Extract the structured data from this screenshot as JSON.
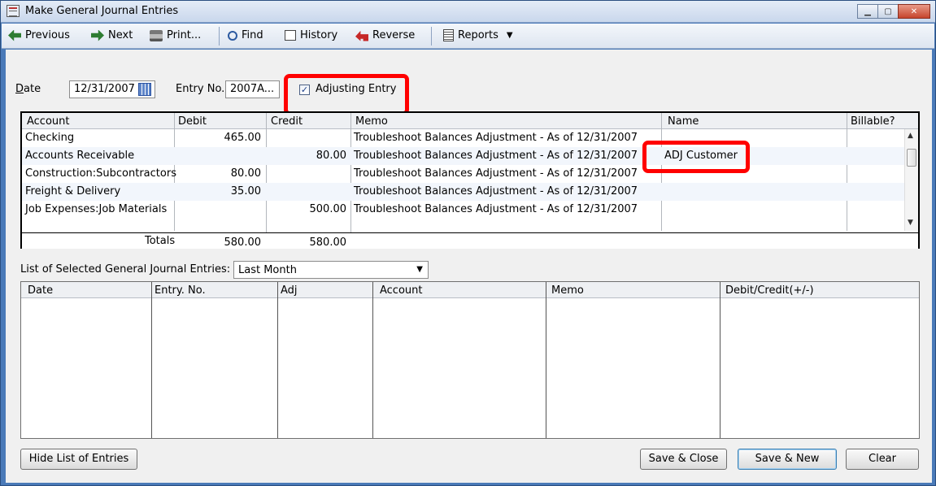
{
  "window": {
    "title": "Make General Journal Entries",
    "min_icon": "minimize-icon",
    "max_icon": "maximize-icon",
    "close_icon": "close-icon"
  },
  "toolbar": {
    "previous": "Previous",
    "next": "Next",
    "print": "Print...",
    "find": "Find",
    "history": "History",
    "reverse": "Reverse",
    "reports": "Reports"
  },
  "header": {
    "date_label": "Date",
    "date_value": "12/31/2007",
    "entry_label": "Entry No.",
    "entry_value": "2007A...",
    "adjusting_label": "Adjusting Entry",
    "adjusting_checked": "✓"
  },
  "grid": {
    "columns": [
      "Account",
      "Debit",
      "Credit",
      "Memo",
      "Name",
      "Billable?"
    ],
    "rows": [
      {
        "account": "Checking",
        "debit": "465.00",
        "credit": "",
        "memo": "Troubleshoot Balances Adjustment - As of 12/31/2007",
        "name": ""
      },
      {
        "account": "Accounts Receivable",
        "debit": "",
        "credit": "80.00",
        "memo": "Troubleshoot Balances Adjustment - As of 12/31/2007",
        "name": "ADJ Customer"
      },
      {
        "account": "Construction:Subcontractors",
        "debit": "80.00",
        "credit": "",
        "memo": "Troubleshoot Balances Adjustment - As of 12/31/2007",
        "name": ""
      },
      {
        "account": "Freight & Delivery",
        "debit": "35.00",
        "credit": "",
        "memo": "Troubleshoot Balances Adjustment - As of 12/31/2007",
        "name": ""
      },
      {
        "account": "Job Expenses:Job Materials",
        "debit": "",
        "credit": "500.00",
        "memo": "Troubleshoot Balances Adjustment - As of 12/31/2007",
        "name": ""
      }
    ],
    "totals_label": "Totals",
    "total_debit": "580.00",
    "total_credit": "580.00"
  },
  "list": {
    "label": "List of Selected General Journal Entries:",
    "filter_value": "Last Month",
    "columns": [
      "Date",
      "Entry. No.",
      "Adj",
      "Account",
      "Memo",
      "Debit/Credit(+/-)"
    ]
  },
  "buttons": {
    "hide_list": "Hide List of Entries",
    "save_close": "Save & Close",
    "save_new": "Save & New",
    "clear": "Clear"
  },
  "colors": {
    "highlight": "#ff0000",
    "title_bar": "#c9d7ec",
    "frame": "#4a7ab8"
  }
}
